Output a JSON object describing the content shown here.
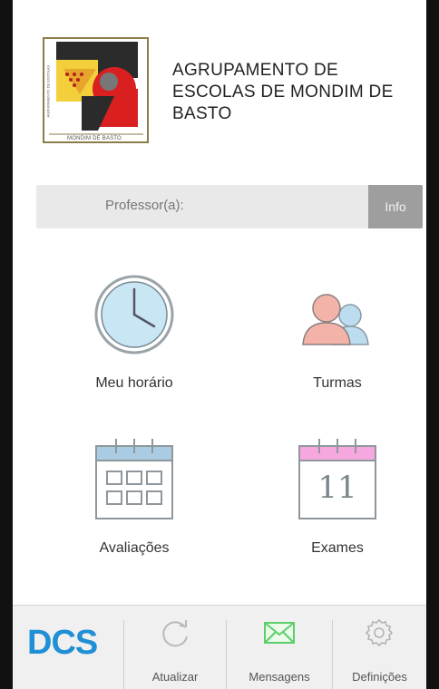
{
  "header": {
    "school_name": "AGRUPAMENTO DE ESCOLAS DE MONDIM DE BASTO",
    "logo_caption": "MONDIM DE BASTO",
    "logo_side_text": "AGRUPAMENTO DE ESCOLAS"
  },
  "profile": {
    "label": "Professor(a):",
    "info_button": "Info"
  },
  "tiles": [
    {
      "label": "Meu horário",
      "icon": "clock-icon"
    },
    {
      "label": "Turmas",
      "icon": "users-icon"
    },
    {
      "label": "Avaliações",
      "icon": "calendar-grid-icon"
    },
    {
      "label": "Exames",
      "icon": "calendar-day-icon",
      "day": "11"
    }
  ],
  "tabbar": {
    "brand": "DCS",
    "items": [
      {
        "label": "Atualizar",
        "icon": "refresh-icon"
      },
      {
        "label": "Mensagens",
        "icon": "mail-icon"
      },
      {
        "label": "Definições",
        "icon": "gear-icon"
      }
    ]
  },
  "colors": {
    "clock_fill": "#c9e6f5",
    "user_front": "#f4b3a8",
    "user_back": "#bcdcef",
    "calendar_blue": "#a9cce3",
    "calendar_pink": "#f6a8de",
    "mail_green": "#5ccf6a",
    "brand_blue": "#1f8fd6",
    "info_button_bg": "#9e9e9e"
  }
}
